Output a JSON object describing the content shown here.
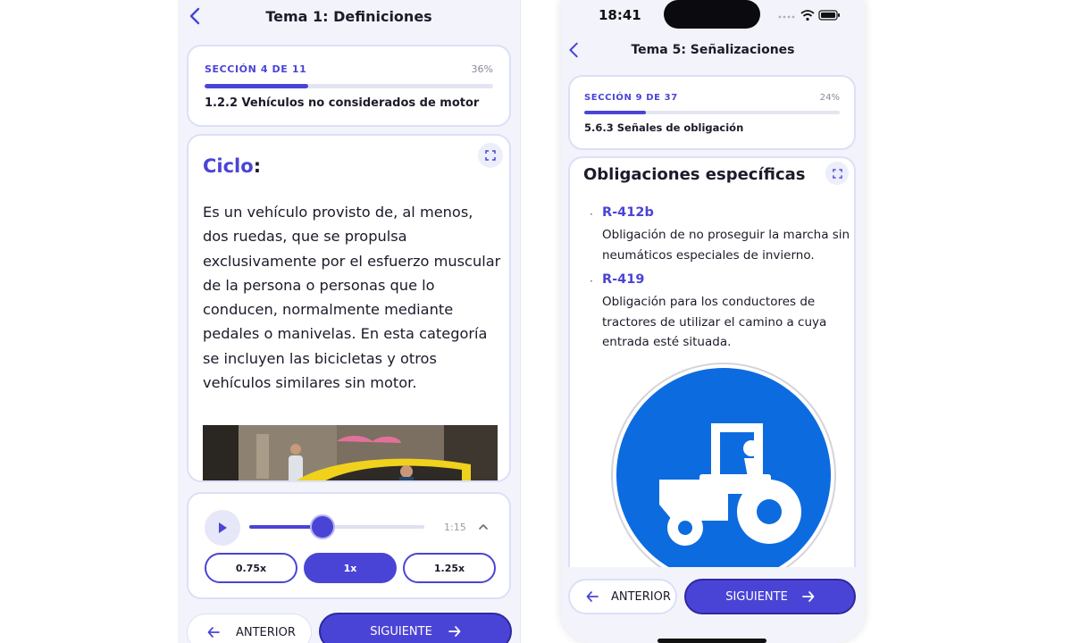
{
  "left": {
    "nav_title": "Tema 1: Definiciones",
    "section": {
      "label": "SECCIÓN 4 DE 11",
      "percent": "36%",
      "progress_fraction": 0.36,
      "subtitle": "1.2.2 Vehículos no considerados de motor"
    },
    "content": {
      "term": "Ciclo",
      "colon": ":",
      "body": "Es un vehículo provisto de, al menos, dos ruedas, que se propulsa exclusivamente por el esfuerzo muscular de la persona o personas que lo conducen, normalmente mediante pedales o manivelas. En esta categoría se incluyen las bicicletas y otros vehículos similares sin motor."
    },
    "audio": {
      "time": "1:15",
      "progress_fraction": 0.42,
      "speeds": [
        "0.75x",
        "1x",
        "1.25x"
      ],
      "selected_speed": "1x"
    },
    "footer": {
      "prev_label": "ANTERIOR",
      "next_label": "SIGUIENTE"
    }
  },
  "right": {
    "status_time": "18:41",
    "nav_title": "Tema 5: Señalizaciones",
    "section": {
      "label": "SECCIÓN 9 DE 37",
      "percent": "24%",
      "progress_fraction": 0.24,
      "subtitle": "5.6.3 Señales de obligación"
    },
    "content": {
      "title": "Obligaciones específicas",
      "items": [
        {
          "code": "R-412b",
          "desc": "Obligación de no proseguir la marcha sin neumáticos especiales de invierno."
        },
        {
          "code": "R-419",
          "desc": "Obligación para los conductores de tractores de utilizar el camino a cuya entrada esté situada."
        }
      ],
      "sign_color": "#0d6be0"
    },
    "footer": {
      "prev_label": "ANTERIOR",
      "next_label": "SIGUIENTE"
    }
  },
  "colors": {
    "accent": "#4a44d6",
    "card_border": "#dcdff7",
    "background": "#f3f4fb"
  },
  "icons": [
    "back-chevron-icon",
    "expand-icon",
    "play-icon",
    "chevron-up-icon",
    "arrow-left-icon",
    "arrow-right-icon",
    "signal-icon",
    "wifi-icon",
    "battery-icon",
    "tractor-sign-icon"
  ]
}
